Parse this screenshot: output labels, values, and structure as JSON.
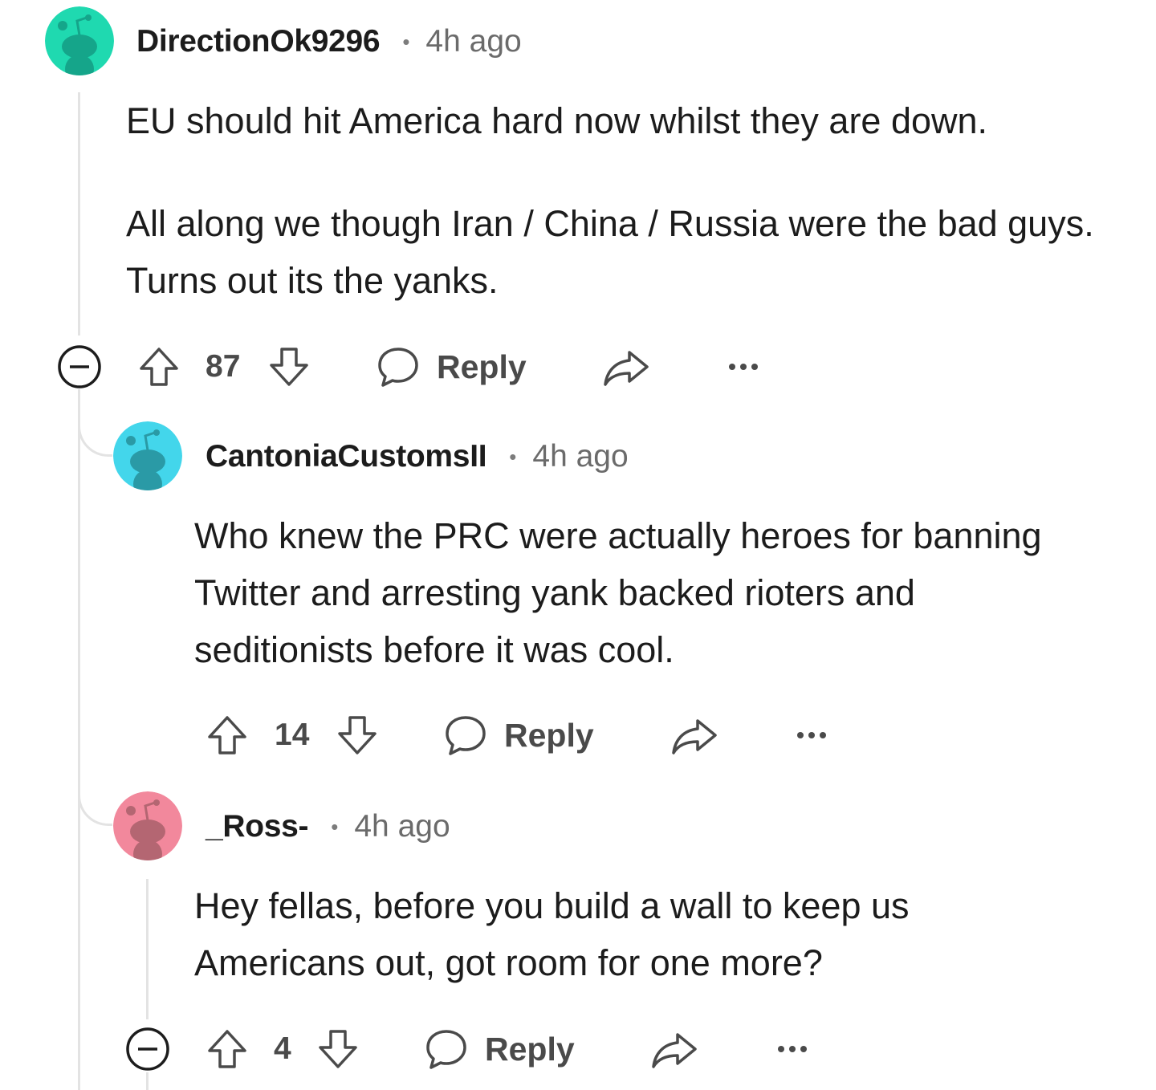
{
  "comments": [
    {
      "username": "DirectionOk9296",
      "time": "4h ago",
      "avatar_color": "#1fd9b0",
      "paragraphs": [
        "EU should hit America hard now whilst they are down.",
        "All along we though Iran / China / Russia were the bad guys. Turns out its the yanks."
      ],
      "votes": "87",
      "reply_label": "Reply"
    },
    {
      "username": "CantoniaCustomsII",
      "time": "4h ago",
      "avatar_color": "#43d6eb",
      "paragraphs": [
        "Who knew the PRC were actually heroes for banning Twitter and arresting yank backed rioters and seditionists before it was cool."
      ],
      "votes": "14",
      "reply_label": "Reply"
    },
    {
      "username": "_Ross-",
      "time": "4h ago",
      "avatar_color": "#f2889c",
      "paragraphs": [
        "Hey fellas, before you build a wall to keep us Americans out, got room for one more?"
      ],
      "votes": "4",
      "reply_label": "Reply"
    }
  ],
  "dot_separator": "•",
  "icons": [
    "avatar-icon",
    "collapse-icon",
    "upvote-icon",
    "downvote-icon",
    "reply-icon",
    "share-icon",
    "more-options-icon"
  ]
}
